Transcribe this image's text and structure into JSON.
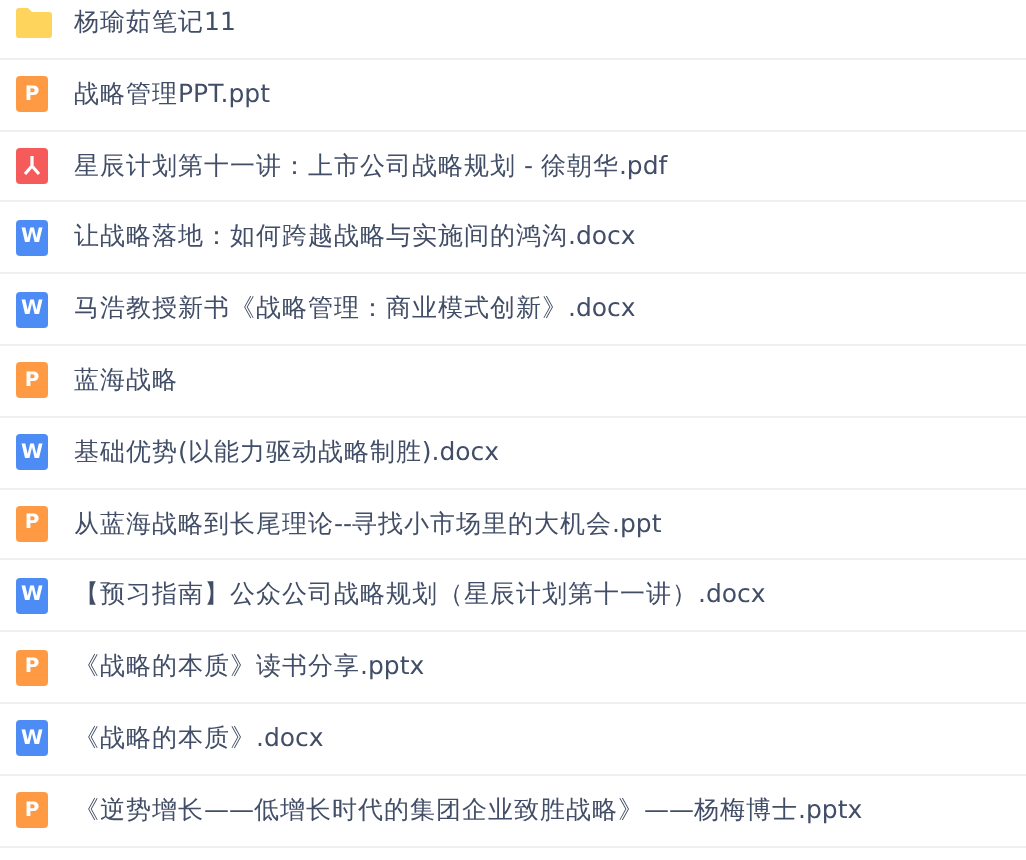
{
  "files": [
    {
      "kind": "folder",
      "name": "杨瑜茹笔记11"
    },
    {
      "kind": "ppt",
      "icon_letter": "P",
      "name": "战略管理PPT.ppt"
    },
    {
      "kind": "pdf",
      "name": "星辰计划第十一讲：上市公司战略规划 - 徐朝华.pdf"
    },
    {
      "kind": "word",
      "icon_letter": "W",
      "name": "让战略落地：如何跨越战略与实施间的鸿沟.docx"
    },
    {
      "kind": "word",
      "icon_letter": "W",
      "name": "马浩教授新书《战略管理：商业模式创新》.docx"
    },
    {
      "kind": "ppt",
      "icon_letter": "P",
      "name": "蓝海战略"
    },
    {
      "kind": "word",
      "icon_letter": "W",
      "name": "基础优势(以能力驱动战略制胜).docx"
    },
    {
      "kind": "ppt",
      "icon_letter": "P",
      "name": "从蓝海战略到长尾理论--寻找小市场里的大机会.ppt"
    },
    {
      "kind": "word",
      "icon_letter": "W",
      "name": "【预习指南】公众公司战略规划（星辰计划第十一讲）.docx"
    },
    {
      "kind": "ppt",
      "icon_letter": "P",
      "name": "《战略的本质》读书分享.pptx"
    },
    {
      "kind": "word",
      "icon_letter": "W",
      "name": "《战略的本质》.docx"
    },
    {
      "kind": "ppt",
      "icon_letter": "P",
      "name": "《逆势增长——低增长时代的集团企业致胜战略》——杨梅博士.pptx"
    }
  ]
}
